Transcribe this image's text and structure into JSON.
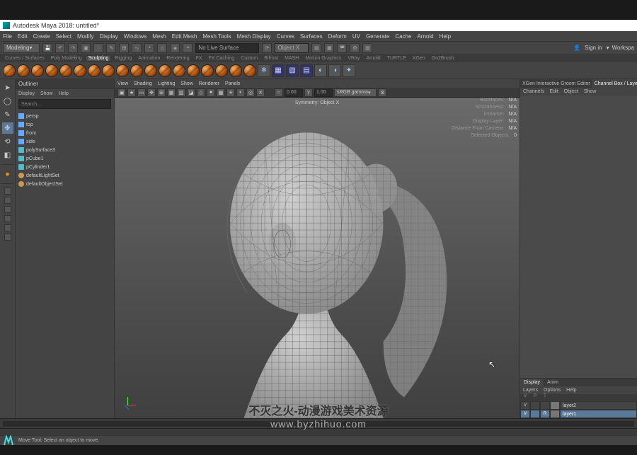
{
  "titlebar": {
    "text": "Autodesk Maya 2018: untitled*"
  },
  "menubar": [
    "File",
    "Edit",
    "Create",
    "Select",
    "Modify",
    "Display",
    "Windows",
    "Mesh",
    "Edit Mesh",
    "Mesh Tools",
    "Mesh Display",
    "Curves",
    "Surfaces",
    "Deform",
    "UV",
    "Generate",
    "Cache",
    "Arnold",
    "Help"
  ],
  "toolbar": {
    "workspace_selector": "Modeling",
    "live_surface": "No Live Surface",
    "symmetry_target": "Object X",
    "workspace_label_right": "Workspa",
    "signin": "Sign in"
  },
  "shelf_tabs": [
    "Curves / Surfaces",
    "Poly Modeling",
    "Sculpting",
    "Rigging",
    "Animation",
    "Rendering",
    "FX",
    "FX Caching",
    "Custom",
    "Bifrost",
    "MASH",
    "Motion Graphics",
    "VRay",
    "Arnold",
    "TURTLE",
    "XGen",
    "Go2Brush"
  ],
  "shelf_active": "Sculpting",
  "outliner": {
    "title": "Outliner",
    "menu": [
      "Display",
      "Show",
      "Help"
    ],
    "search_placeholder": "Search...",
    "items": [
      {
        "label": "persp",
        "kind": "cam"
      },
      {
        "label": "top",
        "kind": "cam"
      },
      {
        "label": "front",
        "kind": "cam"
      },
      {
        "label": "side",
        "kind": "cam"
      },
      {
        "label": "polySurface3",
        "kind": "mesh"
      },
      {
        "label": "pCube1",
        "kind": "mesh"
      },
      {
        "label": "pCylinder1",
        "kind": "mesh"
      },
      {
        "label": "defaultLightSet",
        "kind": "set"
      },
      {
        "label": "defaultObjectSet",
        "kind": "set"
      }
    ]
  },
  "viewport": {
    "menu": [
      "View",
      "Shading",
      "Lighting",
      "Show",
      "Renderer",
      "Panels"
    ],
    "toolbar": {
      "near": "0.00",
      "far": "1.00",
      "colorspace": "sRGB gamma"
    },
    "hud_symmetry": "Symmetry: Object X",
    "stats": [
      {
        "k": "Backfaces:",
        "v": "N/A"
      },
      {
        "k": "Smoothness:",
        "v": "N/A"
      },
      {
        "k": "Instance:",
        "v": "N/A"
      },
      {
        "k": "Display Layer:",
        "v": "N/A"
      },
      {
        "k": "Distance From Camera:",
        "v": "N/A"
      },
      {
        "k": "Selected Objects:",
        "v": "0"
      }
    ]
  },
  "right_panel": {
    "tabs": [
      "XGen Interactive Groom Editor",
      "Channel Box / Layer"
    ],
    "active_tab": 1,
    "channel_menu": [
      "Channels",
      "Edit",
      "Object",
      "Show"
    ],
    "layers": {
      "tabs": [
        "Display",
        "Anim"
      ],
      "active_tab": 0,
      "menu": [
        "Layers",
        "Options",
        "Help"
      ],
      "head": [
        "V",
        "P",
        "T",
        ""
      ],
      "rows": [
        {
          "v": "V",
          "p": "",
          "t": "",
          "name": "layer2",
          "sel": false
        },
        {
          "v": "V",
          "p": "",
          "t": "R",
          "name": "layer1",
          "sel": true
        }
      ]
    }
  },
  "status": {
    "help": "Move Tool: Select an object to move."
  },
  "watermark": {
    "line1": "不灭之火-动漫游戏美术资源",
    "line2": "www.byzhihuo.com"
  }
}
